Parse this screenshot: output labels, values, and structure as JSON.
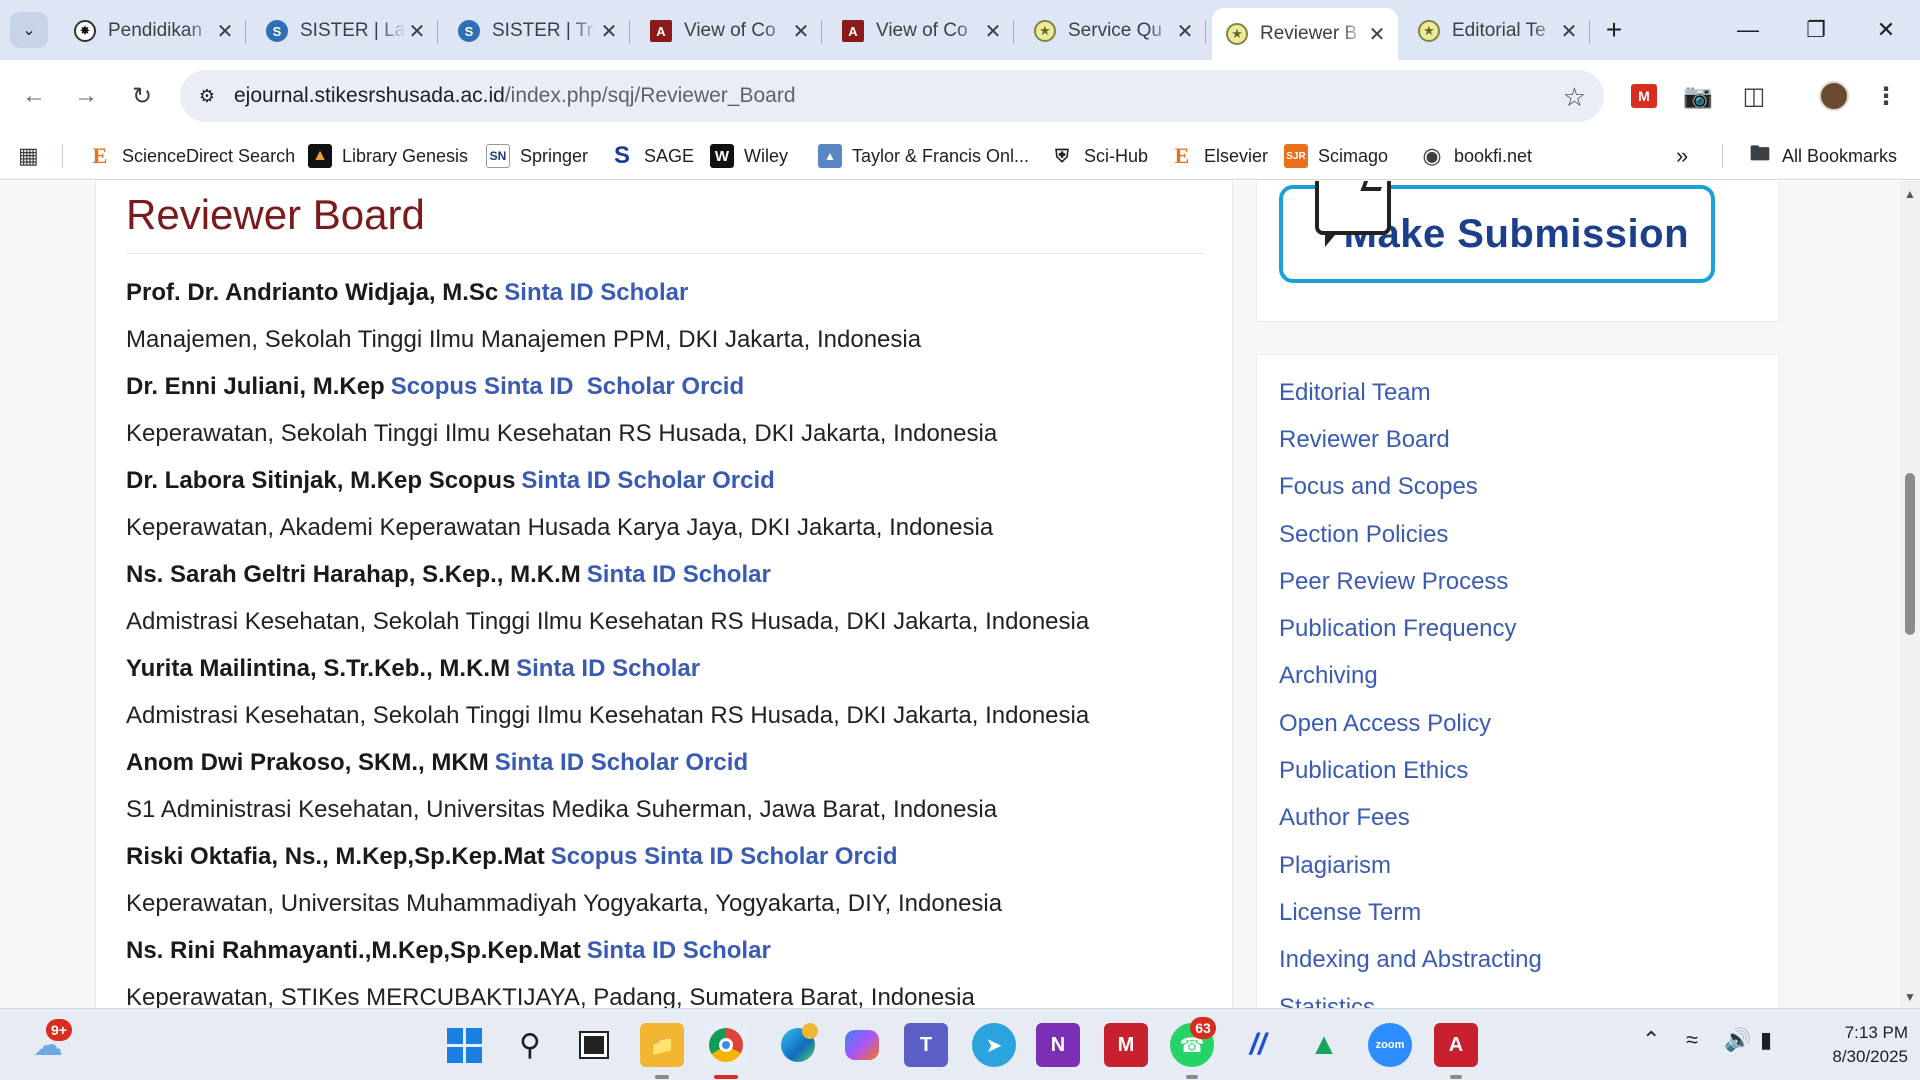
{
  "tabs": [
    {
      "title": "Pendidikan",
      "favicon": "openai-icon"
    },
    {
      "title": "SISTER | La",
      "favicon": "sister-icon"
    },
    {
      "title": "SISTER | Tr",
      "favicon": "sister-icon"
    },
    {
      "title": "View of Co",
      "favicon": "journal-icon"
    },
    {
      "title": "View of Co",
      "favicon": "journal-icon"
    },
    {
      "title": "Service Qu",
      "favicon": "seal-icon"
    },
    {
      "title": "Reviewer B",
      "favicon": "seal-icon",
      "active": true
    },
    {
      "title": "Editorial Te",
      "favicon": "seal-icon"
    }
  ],
  "address": {
    "domain": "ejournal.stikesrshusada.ac.id",
    "path": "/index.php/sqj/Reviewer_Board"
  },
  "bookmarks": [
    {
      "label": "ScienceDirect Search",
      "icon": "E"
    },
    {
      "label": "Library Genesis",
      "icon": ""
    },
    {
      "label": "Springer",
      "icon": "SN"
    },
    {
      "label": "SAGE",
      "icon": "S"
    },
    {
      "label": "Wiley",
      "icon": "W"
    },
    {
      "label": "Taylor & Francis Onl...",
      "icon": ""
    },
    {
      "label": "Sci-Hub",
      "icon": ""
    },
    {
      "label": "Elsevier",
      "icon": "E"
    },
    {
      "label": "Scimago",
      "icon": "SJR"
    },
    {
      "label": "bookfi.net",
      "icon": ""
    }
  ],
  "bookmarks_more": "»",
  "all_bookmarks": "All Bookmarks",
  "page": {
    "title": "Reviewer Board",
    "reviewers": [
      {
        "name": "Prof. Dr. Andrianto Widjaja, M.Sc",
        "links": "Sinta ID Scholar",
        "affiliation": "Manajemen, Sekolah Tinggi Ilmu Manajemen PPM, DKI Jakarta, Indonesia"
      },
      {
        "name": "Dr. Enni Juliani, M.Kep",
        "links": "Scopus Sinta ID  Scholar Orcid",
        "affiliation": "Keperawatan, Sekolah Tinggi Ilmu Kesehatan RS Husada, DKI Jakarta, Indonesia"
      },
      {
        "name": "Dr. Labora Sitinjak, M.Kep Scopus",
        "links": "Sinta ID Scholar Orcid",
        "affiliation": "Keperawatan, Akademi Keperawatan Husada Karya Jaya, DKI Jakarta, Indonesia"
      },
      {
        "name": "Ns. Sarah Geltri Harahap, S.Kep., M.K.M",
        "links": "Sinta ID Scholar",
        "affiliation": "Admistrasi Kesehatan, Sekolah Tinggi Ilmu Kesehatan RS Husada, DKI Jakarta, Indonesia"
      },
      {
        "name": "Yurita Mailintina, S.Tr.Keb., M.K.M",
        "links": "Sinta ID Scholar",
        "affiliation": "Admistrasi Kesehatan, Sekolah Tinggi Ilmu Kesehatan RS Husada, DKI Jakarta, Indonesia"
      },
      {
        "name": "Anom Dwi Prakoso, SKM., MKM",
        "links": "Sinta ID Scholar Orcid",
        "affiliation": "S1 Administrasi Kesehatan, Universitas Medika Suherman, Jawa Barat, Indonesia"
      },
      {
        "name": "Riski Oktafia, Ns., M.Kep,Sp.Kep.Mat",
        "links": "Scopus Sinta ID Scholar Orcid",
        "affiliation": "Keperawatan, Universitas Muhammadiyah Yogyakarta, Yogyakarta, DIY, Indonesia"
      },
      {
        "name": "Ns. Rini Rahmayanti.,M.Kep,Sp.Kep.Mat",
        "links": "Sinta ID Scholar",
        "affiliation": "Keperawatan, STIKes MERCUBAKTIJAYA, Padang, Sumatera Barat, Indonesia"
      }
    ]
  },
  "sidebar": {
    "submit_label": "Make Submission",
    "links": [
      "Editorial Team",
      "Reviewer Board",
      "Focus and Scopes",
      "Section Policies",
      "Peer Review Process",
      "Publication Frequency",
      "Archiving",
      "Open Access Policy",
      "Publication Ethics",
      "Author Fees",
      "Plagiarism",
      "License Term",
      "Indexing and Abstracting",
      "Statistics"
    ]
  },
  "taskbar": {
    "weather_badge": "9+",
    "whatsapp_badge": "63",
    "time": "7:13 PM",
    "date": "8/30/2025"
  },
  "colors": {
    "link": "#3a5bb4",
    "title": "#7a1a1a",
    "tabstrip": "#dee6f5",
    "submit_border": "#1aa0d6"
  }
}
